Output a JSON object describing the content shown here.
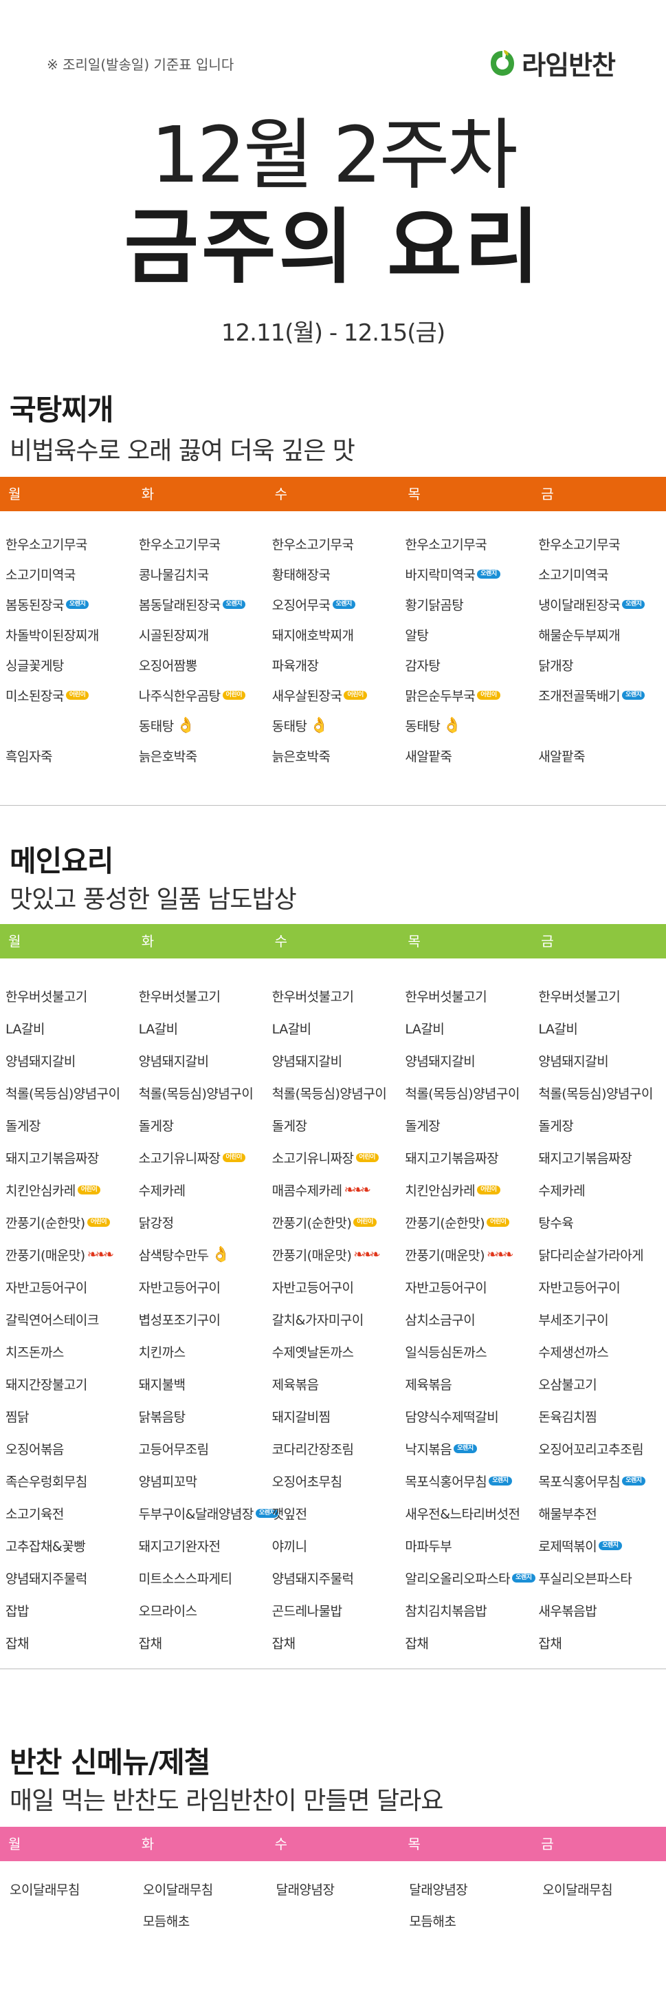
{
  "header": {
    "note": "※ 조리일(발송일) 기준표 입니다",
    "brand": "라임반찬",
    "brand_color": "#3aa23a"
  },
  "hero": {
    "week": "12월 2주차",
    "title": "금주의 요리",
    "date_range": "12.11(월) - 12.15(금)"
  },
  "days": [
    "월",
    "화",
    "수",
    "목",
    "금"
  ],
  "sections": [
    {
      "title": "국탕찌개",
      "subtitle": "비법육수로 오래 끓여 더욱 깊은 맛",
      "color": "#e8650c",
      "columns": [
        [
          {
            "name": "한우소고기무국"
          },
          {
            "name": "소고기미역국"
          },
          {
            "name": "봄동된장국",
            "badge": "오렌지",
            "badge_color": "blue"
          },
          {
            "name": "차돌박이된장찌개"
          },
          {
            "name": "싱글꽃게탕"
          },
          {
            "name": "미소된장국",
            "badge": "어린이",
            "badge_color": "yellow"
          },
          {
            "name": ""
          },
          {
            "name": "흑임자죽"
          }
        ],
        [
          {
            "name": "한우소고기무국"
          },
          {
            "name": "콩나물김치국"
          },
          {
            "name": "봄동달래된장국",
            "badge": "오렌지",
            "badge_color": "blue"
          },
          {
            "name": "시골된장찌개"
          },
          {
            "name": "오징어짬뽕"
          },
          {
            "name": "나주식한우곰탕",
            "badge": "어린이",
            "badge_color": "yellow"
          },
          {
            "name": "동태탕",
            "icon": "hand-icon"
          },
          {
            "name": "늙은호박죽"
          }
        ],
        [
          {
            "name": "한우소고기무국"
          },
          {
            "name": "황태해장국"
          },
          {
            "name": "오징어무국",
            "badge": "오렌지",
            "badge_color": "blue"
          },
          {
            "name": "돼지애호박찌개"
          },
          {
            "name": "파육개장"
          },
          {
            "name": "새우살된장국",
            "badge": "어린이",
            "badge_color": "yellow"
          },
          {
            "name": "동태탕",
            "icon": "hand-icon"
          },
          {
            "name": "늙은호박죽"
          }
        ],
        [
          {
            "name": "한우소고기무국"
          },
          {
            "name": "바지락미역국",
            "badge": "오렌지",
            "badge_color": "blue"
          },
          {
            "name": "황기닭곰탕"
          },
          {
            "name": "알탕"
          },
          {
            "name": "감자탕"
          },
          {
            "name": "맑은순두부국",
            "badge": "어린이",
            "badge_color": "yellow"
          },
          {
            "name": "동태탕",
            "icon": "hand-icon"
          },
          {
            "name": "새알팥죽"
          }
        ],
        [
          {
            "name": "한우소고기무국"
          },
          {
            "name": "소고기미역국"
          },
          {
            "name": "냉이달래된장국",
            "badge": "오렌지",
            "badge_color": "blue"
          },
          {
            "name": "해물순두부찌개"
          },
          {
            "name": "닭개장"
          },
          {
            "name": "조개전골뚝배기",
            "badge": "오렌지",
            "badge_color": "blue"
          },
          {
            "name": ""
          },
          {
            "name": "새알팥죽"
          }
        ]
      ]
    },
    {
      "title": "메인요리",
      "subtitle": "맛있고 풍성한 일품 남도밥상",
      "color": "#8dc63f",
      "columns": [
        [
          {
            "name": "한우버섯불고기"
          },
          {
            "name": "LA갈비"
          },
          {
            "name": "양념돼지갈비"
          },
          {
            "name": "척롤(목등심)양념구이"
          },
          {
            "name": "돌게장"
          },
          {
            "name": "돼지고기볶음짜장"
          },
          {
            "name": "치킨안심카레",
            "badge": "어린이",
            "badge_color": "yellow"
          },
          {
            "name": "깐풍기(순한맛)",
            "badge": "어린이",
            "badge_color": "yellow"
          },
          {
            "name": "깐풍기(매운맛)",
            "icon": "hot-icon"
          },
          {
            "name": "자반고등어구이"
          },
          {
            "name": "갈릭연어스테이크"
          },
          {
            "name": "치즈돈까스"
          },
          {
            "name": "돼지간장불고기"
          },
          {
            "name": "찜닭"
          },
          {
            "name": "오징어볶음"
          },
          {
            "name": "족슨우렁회무침"
          },
          {
            "name": "소고기육전"
          },
          {
            "name": "고추잡채&꽃빵"
          },
          {
            "name": "양념돼지주물럭"
          },
          {
            "name": "잡밥"
          },
          {
            "name": "잡채"
          }
        ],
        [
          {
            "name": "한우버섯불고기"
          },
          {
            "name": "LA갈비"
          },
          {
            "name": "양념돼지갈비"
          },
          {
            "name": "척롤(목등심)양념구이"
          },
          {
            "name": "돌게장"
          },
          {
            "name": "소고기유니짜장",
            "badge": "어린이",
            "badge_color": "yellow"
          },
          {
            "name": "수제카레"
          },
          {
            "name": "닭강정"
          },
          {
            "name": "삼색탕수만두",
            "icon": "hand-icon"
          },
          {
            "name": "자반고등어구이"
          },
          {
            "name": "볍성포조기구이"
          },
          {
            "name": "치킨까스"
          },
          {
            "name": "돼지불백"
          },
          {
            "name": "닭볶음탕"
          },
          {
            "name": "고등어무조림"
          },
          {
            "name": "양념피꼬막"
          },
          {
            "name": "두부구이&달래양념장",
            "badge": "오렌지",
            "badge_color": "blue"
          },
          {
            "name": "돼지고기완자전"
          },
          {
            "name": "미트소스스파게티"
          },
          {
            "name": "오므라이스"
          },
          {
            "name": "잡채"
          }
        ],
        [
          {
            "name": "한우버섯불고기"
          },
          {
            "name": "LA갈비"
          },
          {
            "name": "양념돼지갈비"
          },
          {
            "name": "척롤(목등심)양념구이"
          },
          {
            "name": "돌게장"
          },
          {
            "name": "소고기유니짜장",
            "badge": "어린이",
            "badge_color": "yellow"
          },
          {
            "name": "매콤수제카레",
            "icon": "hot-icon"
          },
          {
            "name": "깐풍기(순한맛)",
            "badge": "어린이",
            "badge_color": "yellow"
          },
          {
            "name": "깐풍기(매운맛)",
            "icon": "hot-icon"
          },
          {
            "name": "자반고등어구이"
          },
          {
            "name": "갈치&가자미구이"
          },
          {
            "name": "수제옛날돈까스"
          },
          {
            "name": "제육볶음"
          },
          {
            "name": "돼지갈비찜"
          },
          {
            "name": "코다리간장조림"
          },
          {
            "name": "오징어초무침"
          },
          {
            "name": "깻잎전"
          },
          {
            "name": "야끼니"
          },
          {
            "name": "양념돼지주물럭"
          },
          {
            "name": "곤드레나물밥"
          },
          {
            "name": "잡채"
          }
        ],
        [
          {
            "name": "한우버섯불고기"
          },
          {
            "name": "LA갈비"
          },
          {
            "name": "양념돼지갈비"
          },
          {
            "name": "척롤(목등심)양념구이"
          },
          {
            "name": "돌게장"
          },
          {
            "name": "돼지고기볶음짜장"
          },
          {
            "name": "치킨안심카레",
            "badge": "어린이",
            "badge_color": "yellow"
          },
          {
            "name": "깐풍기(순한맛)",
            "badge": "어린이",
            "badge_color": "yellow"
          },
          {
            "name": "깐풍기(매운맛)",
            "icon": "hot-icon"
          },
          {
            "name": "자반고등어구이"
          },
          {
            "name": "삼치소금구이"
          },
          {
            "name": "일식등심돈까스"
          },
          {
            "name": "제육볶음"
          },
          {
            "name": "담양식수제떡갈비"
          },
          {
            "name": "낙지볶음",
            "badge": "오렌지",
            "badge_color": "blue"
          },
          {
            "name": "목포식홍어무침",
            "badge": "오렌지",
            "badge_color": "blue"
          },
          {
            "name": "새우전&느타리버섯전"
          },
          {
            "name": "마파두부"
          },
          {
            "name": "알리오올리오파스타",
            "badge": "오렌지",
            "badge_color": "blue"
          },
          {
            "name": "참치김치볶음밥"
          },
          {
            "name": "잡채"
          }
        ],
        [
          {
            "name": "한우버섯불고기"
          },
          {
            "name": "LA갈비"
          },
          {
            "name": "양념돼지갈비"
          },
          {
            "name": "척롤(목등심)양념구이"
          },
          {
            "name": "돌게장"
          },
          {
            "name": "돼지고기볶음짜장"
          },
          {
            "name": "수제카레"
          },
          {
            "name": "탕수육"
          },
          {
            "name": "닭다리순살가라아게"
          },
          {
            "name": "자반고등어구이"
          },
          {
            "name": "부세조기구이"
          },
          {
            "name": "수제생선까스"
          },
          {
            "name": "오삼불고기"
          },
          {
            "name": "돈육김치찜"
          },
          {
            "name": "오징어꼬리고추조림"
          },
          {
            "name": "목포식홍어무침",
            "badge": "오렌지",
            "badge_color": "blue"
          },
          {
            "name": "해물부추전"
          },
          {
            "name": "로제떡볶이",
            "badge": "오렌지",
            "badge_color": "blue"
          },
          {
            "name": "푸실리오븐파스타"
          },
          {
            "name": "새우볶음밥"
          },
          {
            "name": "잡채"
          }
        ]
      ]
    },
    {
      "title": "반찬 신메뉴/제철",
      "subtitle": "매일 먹는 반찬도 라임반찬이 만들면 달라요",
      "color": "#ef6aa4",
      "columns": [
        [
          {
            "name": "오이달래무침"
          }
        ],
        [
          {
            "name": "오이달래무침"
          },
          {
            "name": "모듬해초"
          }
        ],
        [
          {
            "name": "달래양념장"
          }
        ],
        [
          {
            "name": "달래양념장"
          },
          {
            "name": "모듬해초"
          }
        ],
        [
          {
            "name": "오이달래무침"
          }
        ]
      ]
    }
  ]
}
